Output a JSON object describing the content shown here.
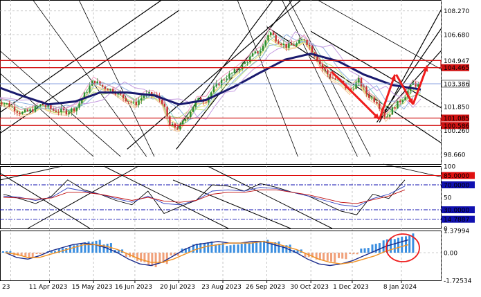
{
  "colors": {
    "background": "#ffffff",
    "grid": "#b8b8b8",
    "price_up": "#2e8b2e",
    "price_down": "#c83232",
    "ma_main": "#1a1a6e",
    "channel": "#000000",
    "level_line": "#e01010",
    "level_box": "#d01010",
    "rsi_main": "#000000",
    "rsi_signal": "#3040c0",
    "rsi_ma": "#c01010",
    "macd_pos": "#3a8ee0",
    "macd_neg": "#f0a07a",
    "macd_line": "#1a2a8a",
    "macd_signal": "#f09020",
    "arrow": "#ee1c1c",
    "circle": "#ee1c1c"
  },
  "chart_data": [
    {
      "type": "candlestick",
      "panel": "price",
      "x": [
        "11 Apr 2023",
        "15 May 2023",
        "16 Jun 2023",
        "20 Jul 2023",
        "23 Aug 2023",
        "26 Sep 2023",
        "30 Oct 2023",
        "1 Dec 2023",
        "8 Jan 2024"
      ],
      "close_path": [
        [
          "2023-03-01",
          102.3
        ],
        [
          "2023-03-10",
          102.0
        ],
        [
          "2023-03-20",
          101.4
        ],
        [
          "2023-03-28",
          101.6
        ],
        [
          "2023-04-05",
          102.0
        ],
        [
          "2023-04-14",
          101.6
        ],
        [
          "2023-04-24",
          101.5
        ],
        [
          "2023-05-02",
          101.8
        ],
        [
          "2023-05-09",
          102.8
        ],
        [
          "2023-05-15",
          103.6
        ],
        [
          "2023-05-22",
          103.2
        ],
        [
          "2023-05-31",
          102.9
        ],
        [
          "2023-06-08",
          102.4
        ],
        [
          "2023-06-16",
          102.0
        ],
        [
          "2023-06-23",
          102.6
        ],
        [
          "2023-06-30",
          102.7
        ],
        [
          "2023-07-07",
          102.2
        ],
        [
          "2023-07-13",
          100.6
        ],
        [
          "2023-07-20",
          100.4
        ],
        [
          "2023-07-27",
          101.3
        ],
        [
          "2023-08-03",
          102.3
        ],
        [
          "2023-08-10",
          102.3
        ],
        [
          "2023-08-17",
          103.2
        ],
        [
          "2023-08-25",
          103.8
        ],
        [
          "2023-09-01",
          104.2
        ],
        [
          "2023-09-08",
          104.7
        ],
        [
          "2023-09-15",
          105.3
        ],
        [
          "2023-09-22",
          105.7
        ],
        [
          "2023-09-28",
          106.9
        ],
        [
          "2023-10-04",
          106.3
        ],
        [
          "2023-10-11",
          105.9
        ],
        [
          "2023-10-18",
          106.0
        ],
        [
          "2023-10-25",
          106.4
        ],
        [
          "2023-11-01",
          105.5
        ],
        [
          "2023-11-08",
          104.4
        ],
        [
          "2023-11-15",
          103.8
        ],
        [
          "2023-11-22",
          103.5
        ],
        [
          "2023-11-29",
          102.9
        ],
        [
          "2023-12-06",
          103.6
        ],
        [
          "2023-12-13",
          102.6
        ],
        [
          "2023-12-20",
          102.2
        ],
        [
          "2023-12-27",
          101.1
        ],
        [
          "2024-01-03",
          101.9
        ],
        [
          "2024-01-10",
          102.5
        ],
        [
          "2024-01-17",
          103.4
        ],
        [
          "2024-01-23",
          103.2
        ]
      ],
      "ma_path": [
        [
          "2023-03-01",
          103.2
        ],
        [
          "2023-03-20",
          102.6
        ],
        [
          "2023-04-10",
          102.0
        ],
        [
          "2023-05-01",
          102.2
        ],
        [
          "2023-05-20",
          102.8
        ],
        [
          "2023-06-10",
          102.8
        ],
        [
          "2023-07-01",
          102.6
        ],
        [
          "2023-07-20",
          102.0
        ],
        [
          "2023-08-10",
          102.3
        ],
        [
          "2023-09-01",
          103.2
        ],
        [
          "2023-09-20",
          104.1
        ],
        [
          "2023-10-10",
          105.0
        ],
        [
          "2023-10-30",
          105.4
        ],
        [
          "2023-11-20",
          104.9
        ],
        [
          "2023-12-10",
          104.0
        ],
        [
          "2024-01-01",
          103.3
        ],
        [
          "2024-01-23",
          103.0
        ]
      ],
      "axis_ticks": [
        "108.270",
        "106.680",
        "104.947",
        "104.465",
        "103.386",
        "101.850",
        "101.085",
        "100.586",
        "100.260",
        "98.660"
      ],
      "levels": [
        {
          "label": "104.947",
          "value": 104.947,
          "style": "line"
        },
        {
          "label": "104.465",
          "value": 104.465,
          "style": "box"
        },
        {
          "label": "103.386",
          "value": 103.386,
          "style": "box"
        },
        {
          "label": "101.085",
          "value": 101.085,
          "style": "box"
        },
        {
          "label": "100.586",
          "value": 100.586,
          "style": "box"
        }
      ],
      "ylim": [
        98.0,
        109.0
      ]
    },
    {
      "type": "line",
      "panel": "oscillator",
      "series": [
        {
          "key": "rsi_main",
          "values": [
            55,
            48,
            40,
            52,
            78,
            62,
            55,
            45,
            38,
            60,
            24,
            35,
            45,
            70,
            68,
            60,
            72,
            66,
            58,
            52,
            40,
            28,
            22,
            55,
            48,
            78
          ]
        },
        {
          "key": "rsi_signal",
          "values": [
            52,
            50,
            45,
            50,
            65,
            60,
            55,
            48,
            42,
            52,
            40,
            38,
            45,
            60,
            62,
            60,
            66,
            64,
            58,
            52,
            45,
            38,
            35,
            48,
            55,
            68
          ]
        },
        {
          "key": "rsi_ma",
          "values": [
            50,
            49,
            47,
            49,
            58,
            58,
            55,
            50,
            45,
            50,
            44,
            42,
            45,
            55,
            58,
            58,
            62,
            62,
            58,
            54,
            48,
            42,
            40,
            46,
            52,
            62
          ]
        }
      ],
      "axis_ticks": [
        "100",
        "85.0000",
        "70.0000",
        "50",
        "30.0000",
        "14.7887",
        "0"
      ],
      "levels": [
        {
          "label": "85.0000",
          "value": 85,
          "color": "#e01010"
        },
        {
          "label": "70.0000",
          "value": 70,
          "color": "#1010b0"
        },
        {
          "label": "30.0000",
          "value": 30,
          "color": "#1010b0"
        },
        {
          "label": "14.7887",
          "value": 14.7887,
          "color": "#1010b0"
        }
      ],
      "ylim": [
        0,
        100
      ]
    },
    {
      "type": "bar",
      "panel": "macd",
      "histogram": [
        0.1,
        -0.2,
        -0.3,
        -0.1,
        0.1,
        0.3,
        0.5,
        0.7,
        0.8,
        0.6,
        0.2,
        -0.3,
        -0.6,
        -0.9,
        -0.7,
        -0.2,
        0.3,
        0.6,
        0.7,
        0.6,
        0.5,
        0.6,
        0.7,
        0.8,
        0.7,
        0.5,
        0.2,
        -0.3,
        -0.5,
        -0.6,
        -0.4,
        -0.1,
        0.3,
        0.6,
        0.9,
        1.0,
        1.2
      ],
      "macd_line": [
        0.0,
        -0.3,
        -0.4,
        -0.2,
        0.1,
        0.3,
        0.5,
        0.6,
        0.5,
        0.3,
        0.0,
        -0.4,
        -0.7,
        -0.8,
        -0.6,
        -0.2,
        0.2,
        0.5,
        0.6,
        0.7,
        0.6,
        0.6,
        0.7,
        0.7,
        0.5,
        0.3,
        0.0,
        -0.4,
        -0.7,
        -0.8,
        -0.7,
        -0.5,
        -0.2,
        0.1,
        0.4,
        0.6,
        0.8
      ],
      "signal_line": [
        0.0,
        -0.1,
        -0.3,
        -0.3,
        -0.1,
        0.1,
        0.3,
        0.5,
        0.5,
        0.4,
        0.2,
        -0.1,
        -0.4,
        -0.6,
        -0.6,
        -0.4,
        -0.1,
        0.2,
        0.4,
        0.5,
        0.6,
        0.6,
        0.6,
        0.7,
        0.6,
        0.4,
        0.2,
        -0.1,
        -0.4,
        -0.6,
        -0.7,
        -0.6,
        -0.4,
        -0.2,
        0.1,
        0.3,
        0.5
      ],
      "axis_ticks": [
        "1.37994",
        "0.00",
        "-1.72534"
      ],
      "ylim": [
        -1.72534,
        1.37994
      ]
    }
  ],
  "x_axis_labels": [
    "23",
    "11 Apr 2023",
    "15 May 2023",
    "16 Jun 2023",
    "20 Jul 2023",
    "23 Aug 2023",
    "26 Sep 2023",
    "30 Oct 2023",
    "1 Dec 2023",
    "8 Jan 2024"
  ]
}
